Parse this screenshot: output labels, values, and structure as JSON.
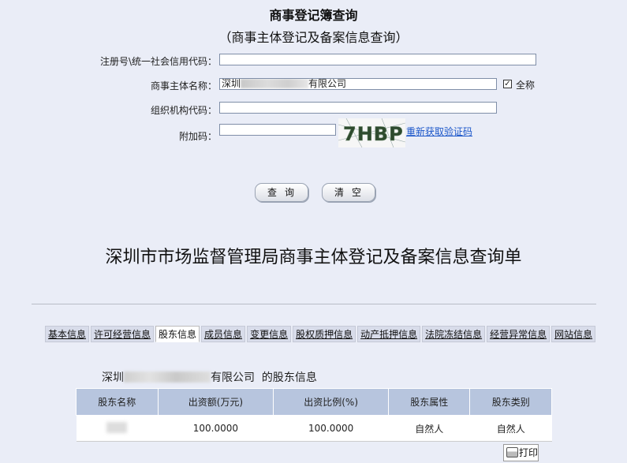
{
  "form": {
    "title": "商事登记簿查询",
    "subtitle": "（商事主体登记及备案信息查询）",
    "fields": {
      "reg_no_label": "注册号\\统一社会信用代码：",
      "reg_no_value": "",
      "name_label": "商事主体名称：",
      "name_prefix": "深圳",
      "name_suffix": "有限公司",
      "fullname_label": "全称",
      "fullname_checked": "✓",
      "org_code_label": "组织机构代码：",
      "org_code_value": "",
      "captcha_label": "附加码：",
      "captcha_value": "",
      "captcha_text": "7HBP",
      "refresh_link": "重新获取验证码"
    },
    "buttons": {
      "query": "查询",
      "clear": "清空"
    }
  },
  "result": {
    "title": "深圳市市场监督管理局商事主体登记及备案信息查询单",
    "tabs": [
      "基本信息",
      "许可经营信息",
      "股东信息",
      "成员信息",
      "变更信息",
      "股权质押信息",
      "动产抵押信息",
      "法院冻结信息",
      "经营异常信息",
      "网站信息"
    ],
    "active_tab": "股东信息",
    "section_prefix": "深圳",
    "section_suffix": "有限公司  的股东信息",
    "table": {
      "headers": [
        "股东名称",
        "出资额(万元)",
        "出资比例(%)",
        "股东属性",
        "股东类别"
      ],
      "rows": [
        {
          "name": "",
          "amount": "100.0000",
          "ratio": "100.0000",
          "attr": "自然人",
          "category": "自然人"
        }
      ]
    },
    "print_label": "打印"
  }
}
